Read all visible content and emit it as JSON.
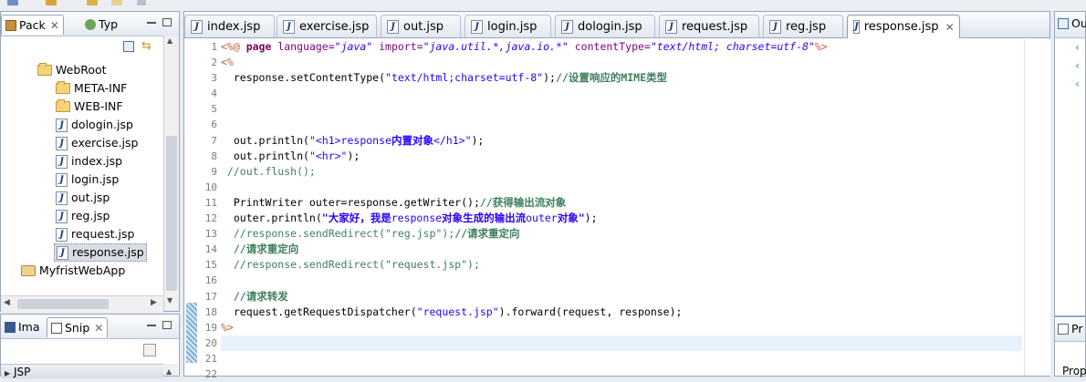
{
  "left_view": {
    "tab_package": "Pack",
    "tab_type": "Typ",
    "tree": [
      {
        "label": "WebRoot",
        "kind": "folder"
      },
      {
        "label": "META-INF",
        "kind": "folder"
      },
      {
        "label": "WEB-INF",
        "kind": "folder"
      },
      {
        "label": "dologin.jsp",
        "kind": "jsp"
      },
      {
        "label": "exercise.jsp",
        "kind": "jsp"
      },
      {
        "label": "index.jsp",
        "kind": "jsp"
      },
      {
        "label": "login.jsp",
        "kind": "jsp"
      },
      {
        "label": "out.jsp",
        "kind": "jsp"
      },
      {
        "label": "reg.jsp",
        "kind": "jsp"
      },
      {
        "label": "request.jsp",
        "kind": "jsp"
      },
      {
        "label": "response.jsp",
        "kind": "jsp",
        "selected": true
      },
      {
        "label": "MyfristWebApp",
        "kind": "project"
      }
    ]
  },
  "lower_view": {
    "tab_image": "Ima",
    "tab_snippets": "Snip",
    "item": "JSP"
  },
  "editor": {
    "tabs": [
      "index.jsp",
      "exercise.jsp",
      "out.jsp",
      "login.jsp",
      "dologin.jsp",
      "request.jsp",
      "reg.jsp",
      "response.jsp"
    ],
    "active_tab": "response.jsp",
    "line_numbers": [
      "1",
      "2",
      "3",
      "4",
      "5",
      "6",
      "7",
      "8",
      "9",
      "10",
      "11",
      "12",
      "13",
      "14",
      "15",
      "16",
      "17",
      "18",
      "19",
      "20",
      "21",
      "22"
    ],
    "code": {
      "l1_a": "<%@ ",
      "l1_b": "page ",
      "l1_c": "language=",
      "l1_d": "\"java\"",
      "l1_e": " import=",
      "l1_f": "\"java.util.*,java.io.*\"",
      "l1_g": " contentType=",
      "l1_h": "\"text/html; charset=utf-8\"",
      "l1_i": "%>",
      "l2": "<%",
      "l3_a": "  response.setContentType(",
      "l3_b": "\"text/html;charset=utf-8\"",
      "l3_c": ");",
      "l3_d": "//设置响应的MIME类型",
      "l7_a": "  out.println(",
      "l7_b": "\"<h1>response",
      "l7_c": "内置对象",
      "l7_d": "</h1>\"",
      "l7_e": ");",
      "l8_a": "  out.println(",
      "l8_b": "\"<hr>\"",
      "l8_c": ");",
      "l9": " //out.flush();",
      "l11_a": "  PrintWriter outer=response.getWriter();",
      "l11_b": "//获得输出流对象",
      "l12_a": "  outer.println(",
      "l12_b": "\"大家好，我是",
      "l12_c": "response",
      "l12_d": "对象生成的输出流",
      "l12_e": "outer",
      "l12_f": "对象\"",
      "l12_g": ");",
      "l13_a": "  //response.sendRedirect(\"reg.jsp\");",
      "l13_b": "//请求重定向",
      "l14": "  //请求重定向",
      "l15": "  //response.sendRedirect(\"request.jsp\");",
      "l17": "  //请求转发",
      "l18_a": "  request.getRequestDispatcher(",
      "l18_b": "\"request.jsp\"",
      "l18_c": ").forward(request, response);",
      "l19": "%>"
    }
  },
  "right_view": {
    "tab_outline": "Ou",
    "tab_props": "Pr",
    "props_label": "Prop"
  }
}
